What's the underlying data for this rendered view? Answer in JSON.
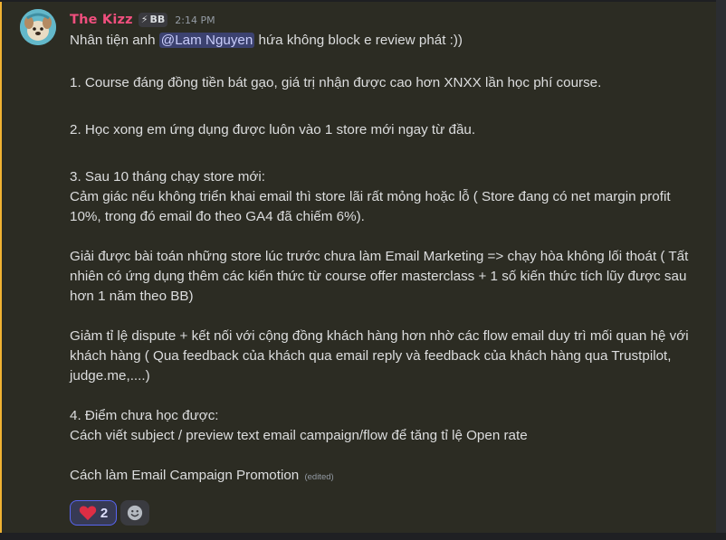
{
  "message": {
    "author": "The Kizz",
    "role_icon": "lightning-bolt-icon",
    "role_tag": "BB",
    "timestamp": "2:14 PM",
    "intro_before": "Nhân tiện anh ",
    "mention": "@Lam Nguyen",
    "intro_after": " hứa không block e review phát :))",
    "point1": "1. Course đáng đồng tiền bát gạo, giá trị nhận được cao hơn XNXX lần học phí course.",
    "point2": "2. Học xong em ứng dụng được luôn vào 1 store mới ngay từ đầu.",
    "point3_title": "3. Sau 10 tháng chạy store mới:",
    "point3_line1_a": "Cảm giác nếu không triển khai email thì store lãi rất mỏng hoặc lỗ ( Store đang có net margin profit",
    "point3_line1_b": "10%, trong đó email đo theo GA4 đã chiếm 6%).",
    "point3_line2_a": "Giải được bài toán những store lúc trước chưa làm Email Marketing => chạy hòa không lối thoát ( Tất",
    "point3_line2_b": "nhiên có ứng dụng thêm các kiến thức từ course offer masterclass + 1 số kiến thức tích lũy được sau",
    "point3_line2_c": "hơn 1 năm theo BB)",
    "point3_line3_a": "Giảm tỉ lệ dispute + kết nối với cộng đồng khách hàng hơn nhờ các flow email duy trì mối quan hệ với",
    "point3_line3_b": "khách hàng ( Qua feedback của khách qua email reply và feedback của khách hàng qua Trustpilot,",
    "point3_line3_c": "judge.me,....)",
    "point4_title": "4. Điểm chưa học được:",
    "point4_line1": "Cách viết subject / preview text email campaign/flow để tăng tỉ lệ Open rate",
    "point4_line2": "Cách làm Email Campaign Promotion",
    "edited_label": "(edited)"
  },
  "reactions": [
    {
      "icon": "heart-icon",
      "count": "2"
    }
  ],
  "add_reaction_icon": "smiley-icon",
  "colors": {
    "background": "#2c2c23",
    "username": "#f04f7e",
    "mention_bg": "#3c4270",
    "reaction_border": "#5865f2",
    "accent_bar": "#f0b232"
  }
}
